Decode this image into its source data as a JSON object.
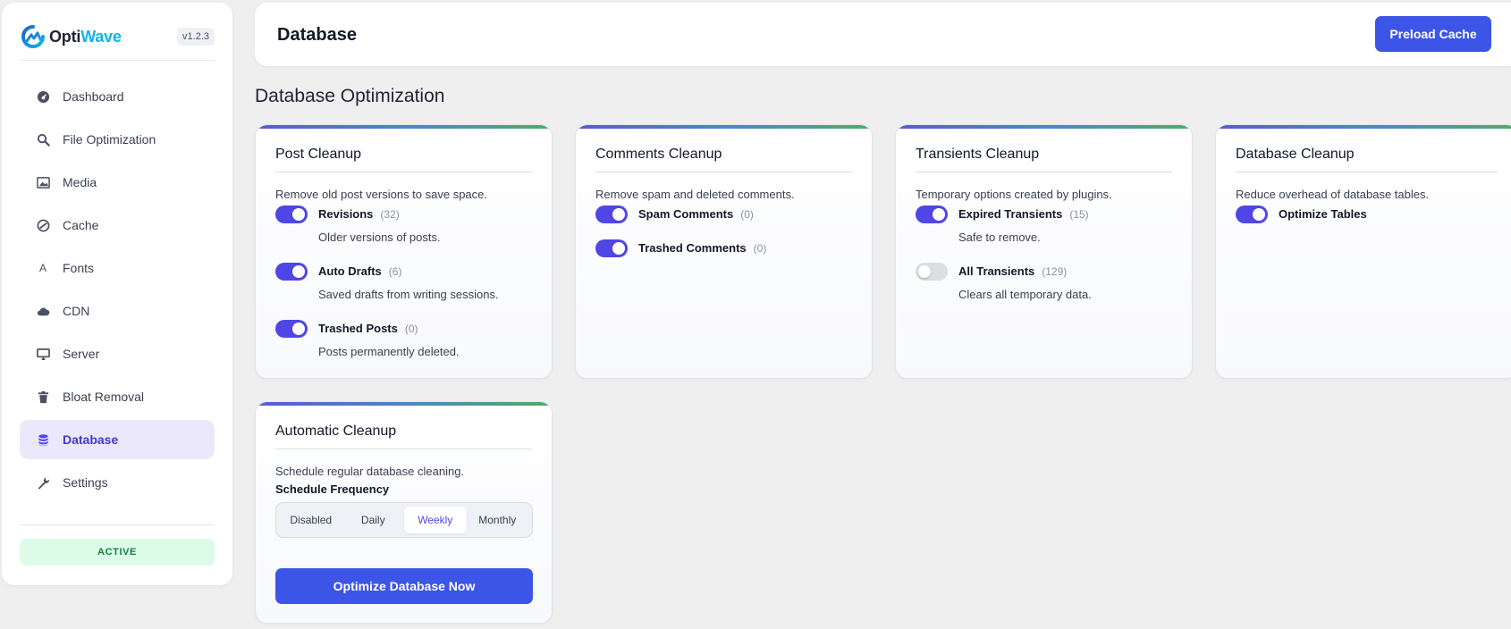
{
  "brand": {
    "name_a": "Opti",
    "name_b": "Wave",
    "version": "v1.2.3"
  },
  "colors": {
    "accent": "#4f46e5",
    "primary_button": "#3d55e6",
    "brand_cyan": "#11b5e4",
    "status_green": "#15803d"
  },
  "sidebar": {
    "items": [
      {
        "label": "Dashboard",
        "icon": "dashboard-gauge-icon"
      },
      {
        "label": "File Optimization",
        "icon": "search-icon"
      },
      {
        "label": "Media",
        "icon": "image-icon"
      },
      {
        "label": "Cache",
        "icon": "cache-icon"
      },
      {
        "label": "Fonts",
        "icon": "font-icon"
      },
      {
        "label": "CDN",
        "icon": "cloud-icon"
      },
      {
        "label": "Server",
        "icon": "monitor-icon"
      },
      {
        "label": "Bloat Removal",
        "icon": "trash-icon"
      },
      {
        "label": "Database",
        "icon": "database-icon",
        "active": true
      },
      {
        "label": "Settings",
        "icon": "wrench-icon"
      }
    ],
    "status": "ACTIVE"
  },
  "header": {
    "title": "Database",
    "preload_button": "Preload Cache"
  },
  "main": {
    "section_title": "Database Optimization",
    "cards": {
      "post": {
        "title": "Post Cleanup",
        "description": "Remove old post versions to save space.",
        "options": [
          {
            "label": "Revisions",
            "count": "(32)",
            "sub": "Older versions of posts.",
            "enabled": true
          },
          {
            "label": "Auto Drafts",
            "count": "(6)",
            "sub": "Saved drafts from writing sessions.",
            "enabled": true
          },
          {
            "label": "Trashed Posts",
            "count": "(0)",
            "sub": "Posts permanently deleted.",
            "enabled": true
          }
        ]
      },
      "comments": {
        "title": "Comments Cleanup",
        "description": "Remove spam and deleted comments.",
        "options": [
          {
            "label": "Spam Comments",
            "count": "(0)",
            "enabled": true
          },
          {
            "label": "Trashed Comments",
            "count": "(0)",
            "enabled": true
          }
        ]
      },
      "transients": {
        "title": "Transients Cleanup",
        "description": "Temporary options created by plugins.",
        "options": [
          {
            "label": "Expired Transients",
            "count": "(15)",
            "sub": "Safe to remove.",
            "enabled": true
          },
          {
            "label": "All Transients",
            "count": "(129)",
            "sub": "Clears all temporary data.",
            "enabled": false
          }
        ]
      },
      "database": {
        "title": "Database Cleanup",
        "description": "Reduce overhead of database tables.",
        "options": [
          {
            "label": "Optimize Tables",
            "enabled": true
          }
        ]
      },
      "automatic": {
        "title": "Automatic Cleanup",
        "description": "Schedule regular database cleaning.",
        "frequency_label": "Schedule Frequency",
        "frequency_options": [
          "Disabled",
          "Daily",
          "Weekly",
          "Monthly"
        ],
        "frequency_selected": "Weekly",
        "run_button": "Optimize Database Now"
      }
    }
  }
}
